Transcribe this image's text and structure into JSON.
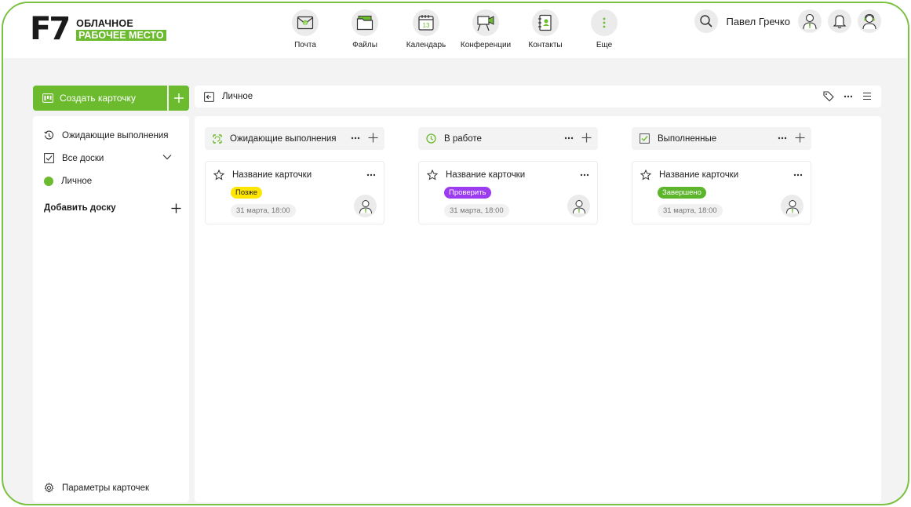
{
  "app": {
    "logo_mark": "F7",
    "logo_line1": "ОБЛАЧНОЕ",
    "logo_line2": "РАБОЧЕЕ МЕСТО"
  },
  "nav": [
    {
      "label": "Почта",
      "icon": "mail-icon"
    },
    {
      "label": "Файлы",
      "icon": "folder-icon"
    },
    {
      "label": "Календарь",
      "icon": "calendar-icon",
      "day": "13"
    },
    {
      "label": "Конференции",
      "icon": "video-conference-icon"
    },
    {
      "label": "Контакты",
      "icon": "contacts-icon"
    },
    {
      "label": "Еще",
      "icon": "more-vertical-icon"
    }
  ],
  "header": {
    "user_name": "Павел Гречко",
    "icons": [
      "search-icon",
      "user-avatar",
      "bell-icon",
      "support-icon"
    ]
  },
  "sidebar": {
    "create_label": "Создать карточку",
    "items": [
      {
        "label": "Ожидающие выполнения",
        "icon": "history-icon"
      },
      {
        "label": "Все доски",
        "icon": "checkbox-icon"
      },
      {
        "label": "Личное",
        "icon": "green-dot"
      }
    ],
    "add_board_label": "Добавить доску",
    "params_label": "Параметры карточек"
  },
  "topbar": {
    "breadcrumb": "Личное"
  },
  "columns": [
    {
      "title": "Ожидающие выполнения",
      "icon": "pending-icon",
      "cards": [
        {
          "title": "Название карточки",
          "badge": "Позже",
          "badge_bg": "#ffe600",
          "badge_fg": "#1e1e1e",
          "date": "31 марта, 18:00"
        }
      ]
    },
    {
      "title": "В работе",
      "icon": "clock-icon",
      "cards": [
        {
          "title": "Название карточки",
          "badge": "Проверить",
          "badge_bg": "#9b3cf0",
          "badge_fg": "#ffffff",
          "date": "31 марта, 18:00"
        }
      ]
    },
    {
      "title": "Выполненные",
      "icon": "checked-icon",
      "cards": [
        {
          "title": "Название карточки",
          "badge": "Завершено",
          "badge_bg": "#5cb52b",
          "badge_fg": "#ffffff",
          "date": "31 марта, 18:00"
        }
      ]
    }
  ],
  "colors": {
    "accent": "#6cbb2f",
    "frame": "#7ac142"
  }
}
